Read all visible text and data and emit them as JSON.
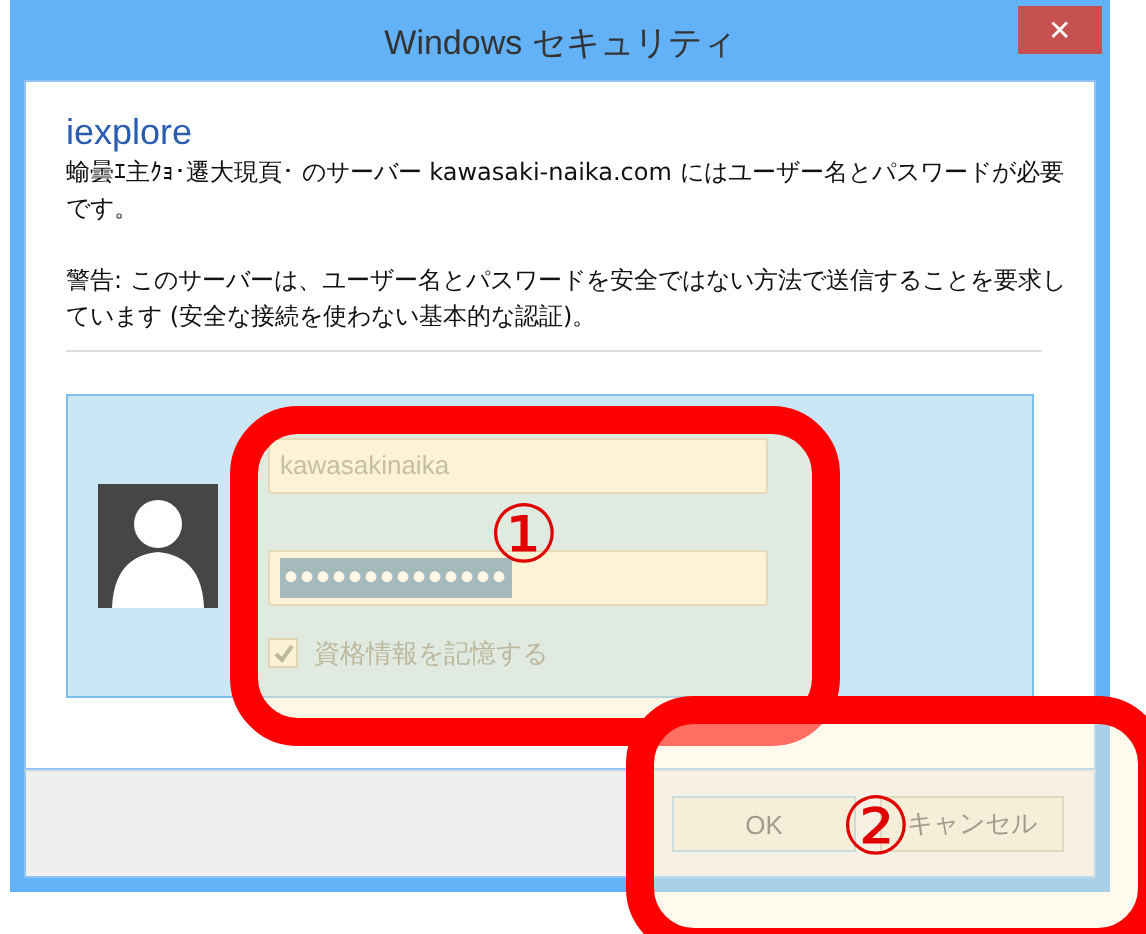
{
  "window": {
    "title": "Windows セキュリティ",
    "close": "✕"
  },
  "app_name": "iexplore",
  "message": "蝓曇ｴ主ｸｮ･遷大現頁･ のサーバー kawasaki-naika.com にはユーザー名とパスワードが必要です。",
  "warning": "警告: このサーバーは、ユーザー名とパスワードを安全ではない方法で送信することを要求しています (安全な接続を使わない基本的な認証)。",
  "credentials": {
    "username": "kawasakinaika",
    "password": "••••••••••••••",
    "password_selected": true,
    "remember": {
      "label": "資格情報を記憶する",
      "checked": true
    }
  },
  "buttons": [
    {
      "label": "OK",
      "default": true
    },
    {
      "label": "キャンセル",
      "default": false
    }
  ],
  "annotations": [
    {
      "label": "①",
      "kind": "fields"
    },
    {
      "label": "②",
      "kind": "buttons"
    }
  ]
}
